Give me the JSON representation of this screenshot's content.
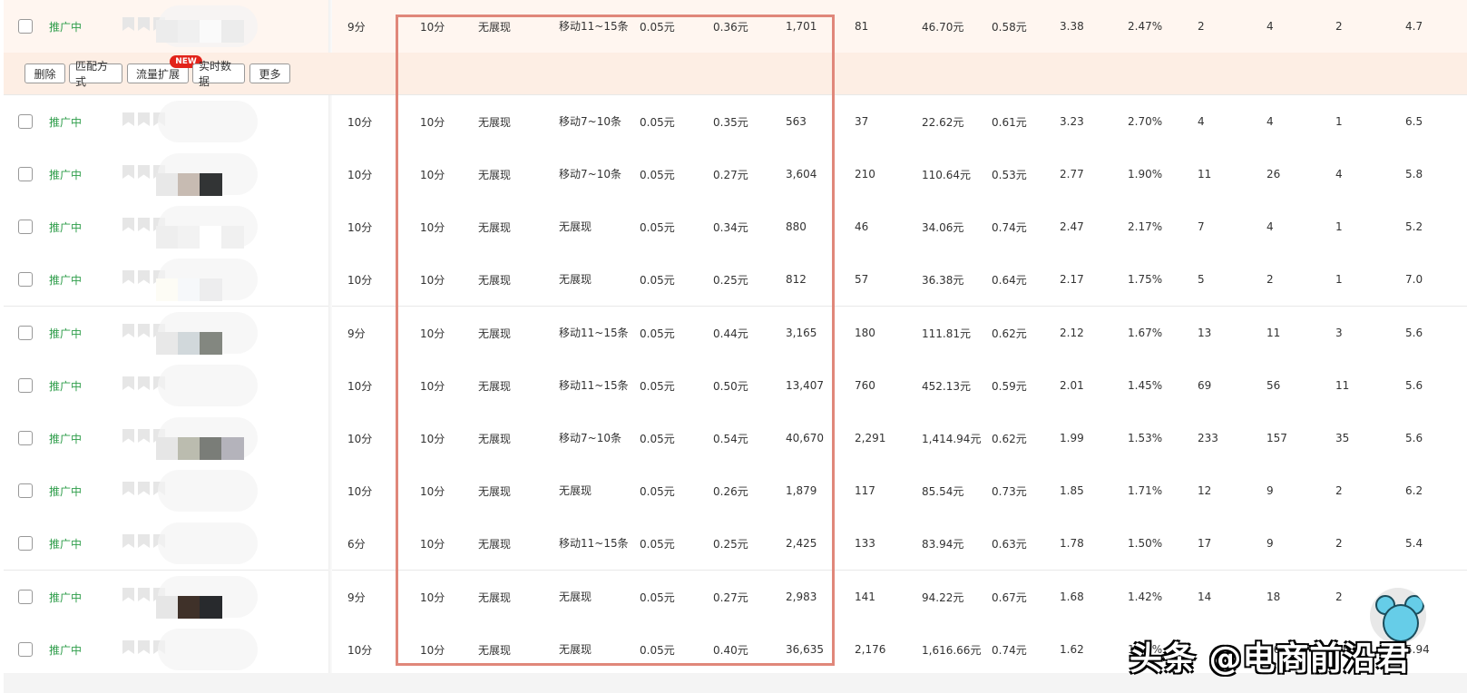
{
  "actions": {
    "delete": "删除",
    "match_type": "匹配方式",
    "traffic_expand": "流量扩展",
    "traffic_expand_badge": "NEW",
    "realtime_data": "实时数据",
    "more": "更多"
  },
  "colors": {
    "status_green": "#2e9d4a",
    "highlight_box": "#e0877a",
    "new_badge": "#e2231a",
    "selected_row_bg": "#fff6f0"
  },
  "watermark": "头条 @电商前沿君",
  "rows": [
    {
      "status": "推广中",
      "quality": "9分",
      "q2": "10分",
      "pc_rank": "无展现",
      "mobile_rank": "移动11~15条",
      "bid": "0.05元",
      "avg_cpc_a": "0.36元",
      "impressions": "1,701",
      "clicks": "81",
      "cost": "46.70元",
      "cpc": "0.58元",
      "roi": "3.38",
      "ctr": "2.47%",
      "c1": "2",
      "c2": "4",
      "c3": "2",
      "c4": "4.7"
    },
    {
      "status": "推广中",
      "quality": "10分",
      "q2": "10分",
      "pc_rank": "无展现",
      "mobile_rank": "移动7~10条",
      "bid": "0.05元",
      "avg_cpc_a": "0.35元",
      "impressions": "563",
      "clicks": "37",
      "cost": "22.62元",
      "cpc": "0.61元",
      "roi": "3.23",
      "ctr": "2.70%",
      "c1": "4",
      "c2": "4",
      "c3": "1",
      "c4": "6.5"
    },
    {
      "status": "推广中",
      "quality": "10分",
      "q2": "10分",
      "pc_rank": "无展现",
      "mobile_rank": "移动7~10条",
      "bid": "0.05元",
      "avg_cpc_a": "0.27元",
      "impressions": "3,604",
      "clicks": "210",
      "cost": "110.64元",
      "cpc": "0.53元",
      "roi": "2.77",
      "ctr": "1.90%",
      "c1": "11",
      "c2": "26",
      "c3": "4",
      "c4": "5.8"
    },
    {
      "status": "推广中",
      "quality": "10分",
      "q2": "10分",
      "pc_rank": "无展现",
      "mobile_rank": "无展现",
      "bid": "0.05元",
      "avg_cpc_a": "0.34元",
      "impressions": "880",
      "clicks": "46",
      "cost": "34.06元",
      "cpc": "0.74元",
      "roi": "2.47",
      "ctr": "2.17%",
      "c1": "7",
      "c2": "4",
      "c3": "1",
      "c4": "5.2"
    },
    {
      "status": "推广中",
      "quality": "10分",
      "q2": "10分",
      "pc_rank": "无展现",
      "mobile_rank": "无展现",
      "bid": "0.05元",
      "avg_cpc_a": "0.25元",
      "impressions": "812",
      "clicks": "57",
      "cost": "36.38元",
      "cpc": "0.64元",
      "roi": "2.17",
      "ctr": "1.75%",
      "c1": "5",
      "c2": "2",
      "c3": "1",
      "c4": "7.0"
    },
    {
      "status": "推广中",
      "quality": "9分",
      "q2": "10分",
      "pc_rank": "无展现",
      "mobile_rank": "移动11~15条",
      "bid": "0.05元",
      "avg_cpc_a": "0.44元",
      "impressions": "3,165",
      "clicks": "180",
      "cost": "111.81元",
      "cpc": "0.62元",
      "roi": "2.12",
      "ctr": "1.67%",
      "c1": "13",
      "c2": "11",
      "c3": "3",
      "c4": "5.6"
    },
    {
      "status": "推广中",
      "quality": "10分",
      "q2": "10分",
      "pc_rank": "无展现",
      "mobile_rank": "移动11~15条",
      "bid": "0.05元",
      "avg_cpc_a": "0.50元",
      "impressions": "13,407",
      "clicks": "760",
      "cost": "452.13元",
      "cpc": "0.59元",
      "roi": "2.01",
      "ctr": "1.45%",
      "c1": "69",
      "c2": "56",
      "c3": "11",
      "c4": "5.6"
    },
    {
      "status": "推广中",
      "quality": "10分",
      "q2": "10分",
      "pc_rank": "无展现",
      "mobile_rank": "移动7~10条",
      "bid": "0.05元",
      "avg_cpc_a": "0.54元",
      "impressions": "40,670",
      "clicks": "2,291",
      "cost": "1,414.94元",
      "cpc": "0.62元",
      "roi": "1.99",
      "ctr": "1.53%",
      "c1": "233",
      "c2": "157",
      "c3": "35",
      "c4": "5.6"
    },
    {
      "status": "推广中",
      "quality": "10分",
      "q2": "10分",
      "pc_rank": "无展现",
      "mobile_rank": "无展现",
      "bid": "0.05元",
      "avg_cpc_a": "0.26元",
      "impressions": "1,879",
      "clicks": "117",
      "cost": "85.54元",
      "cpc": "0.73元",
      "roi": "1.85",
      "ctr": "1.71%",
      "c1": "12",
      "c2": "9",
      "c3": "2",
      "c4": "6.2"
    },
    {
      "status": "推广中",
      "quality": "6分",
      "q2": "10分",
      "pc_rank": "无展现",
      "mobile_rank": "移动11~15条",
      "bid": "0.05元",
      "avg_cpc_a": "0.25元",
      "impressions": "2,425",
      "clicks": "133",
      "cost": "83.94元",
      "cpc": "0.63元",
      "roi": "1.78",
      "ctr": "1.50%",
      "c1": "17",
      "c2": "9",
      "c3": "2",
      "c4": "5.4"
    },
    {
      "status": "推广中",
      "quality": "9分",
      "q2": "10分",
      "pc_rank": "无展现",
      "mobile_rank": "无展现",
      "bid": "0.05元",
      "avg_cpc_a": "0.27元",
      "impressions": "2,983",
      "clicks": "141",
      "cost": "94.22元",
      "cpc": "0.67元",
      "roi": "1.68",
      "ctr": "1.42%",
      "c1": "14",
      "c2": "18",
      "c3": "2",
      "c4": "7"
    },
    {
      "status": "推广中",
      "quality": "10分",
      "q2": "10分",
      "pc_rank": "无展现",
      "mobile_rank": "无展现",
      "bid": "0.05元",
      "avg_cpc_a": "0.40元",
      "impressions": "36,635",
      "clicks": "2,176",
      "cost": "1,616.66元",
      "cpc": "0.74元",
      "roi": "1.62",
      "ctr": "1.52%",
      "c1": "",
      "c2": "168",
      "c3": "35",
      "c4": "5.94"
    }
  ]
}
